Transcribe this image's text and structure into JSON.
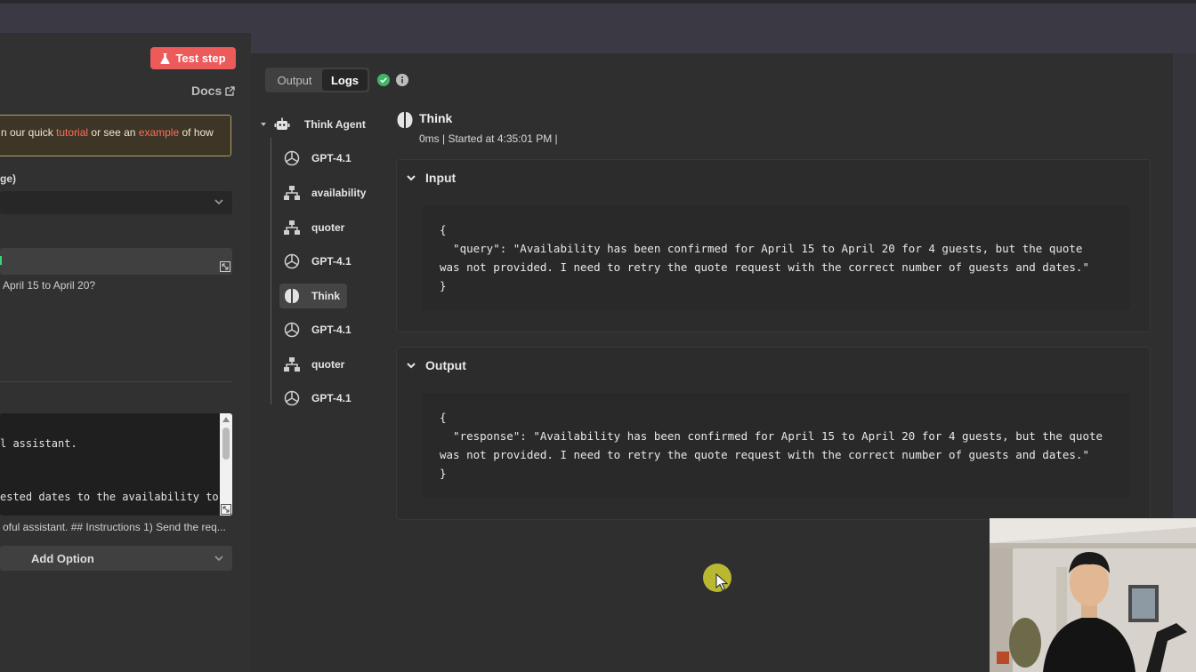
{
  "left_panel": {
    "test_step_label": "Test step",
    "docs_label": "Docs",
    "banner": {
      "prefix": "n our quick ",
      "link1": "tutorial",
      "middle": " or see an ",
      "link2": "example",
      "suffix": " of how"
    },
    "field_label": "ge)",
    "april_text": "April 15 to April 20?",
    "system_message_lines": [
      "l assistant.",
      "ested dates to the availability to"
    ],
    "helpful_text": "oful assistant. ## Instructions 1) Send the req...",
    "add_option_label": "Add Option"
  },
  "logs_panel": {
    "tabs": [
      {
        "label": "Output"
      },
      {
        "label": "Logs"
      }
    ],
    "tree": {
      "root": "Think Agent",
      "items": [
        {
          "label": "GPT-4.1",
          "icon": "openai-icon"
        },
        {
          "label": "availability",
          "icon": "workflow-icon"
        },
        {
          "label": "quoter",
          "icon": "workflow-icon"
        },
        {
          "label": "GPT-4.1",
          "icon": "openai-icon"
        },
        {
          "label": "Think",
          "icon": "brain-icon",
          "selected": true
        },
        {
          "label": "GPT-4.1",
          "icon": "openai-icon"
        },
        {
          "label": "quoter",
          "icon": "workflow-icon"
        },
        {
          "label": "GPT-4.1",
          "icon": "openai-icon"
        }
      ]
    },
    "detail": {
      "title": "Think",
      "meta": "0ms | Started at 4:35:01 PM |",
      "input": {
        "label": "Input",
        "lines": [
          "{",
          "  \"query\": \"Availability has been confirmed for April 15 to April 20 for 4 guests, but the quote",
          "was not provided. I need to retry the quote request with the correct number of guests and dates.\"",
          "}"
        ]
      },
      "output": {
        "label": "Output",
        "lines": [
          "{",
          "  \"response\": \"Availability has been confirmed for April 15 to April 20 for 4 guests, but the quote",
          "was not provided. I need to retry the quote request with the correct number of guests and dates.\"",
          "}"
        ]
      }
    }
  },
  "colors": {
    "accent_red": "#ec5a5a",
    "link_red": "#ff6d5a",
    "success_green": "#3fb56b",
    "banner_border": "#b79f67"
  }
}
